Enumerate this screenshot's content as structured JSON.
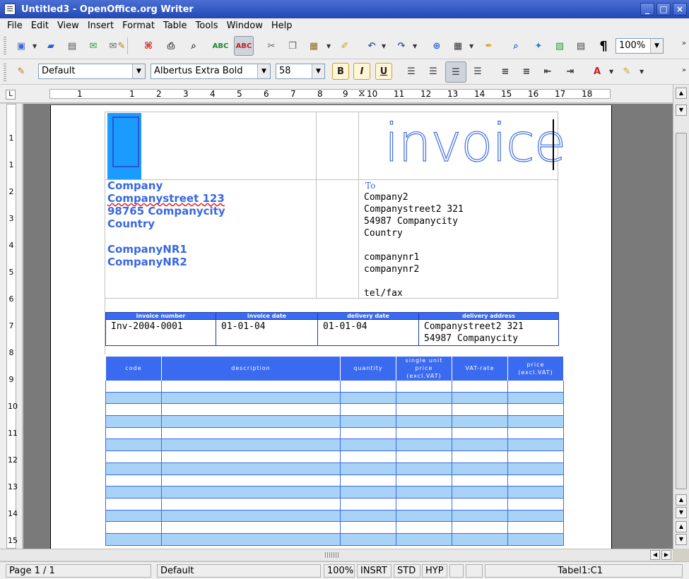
{
  "window": {
    "title": "Untitled3 - OpenOffice.org Writer"
  },
  "menu": [
    "File",
    "Edit",
    "View",
    "Insert",
    "Format",
    "Table",
    "Tools",
    "Window",
    "Help"
  ],
  "toolbar": {
    "zoom": "100%",
    "style": "Default",
    "font": "Albertus Extra Bold",
    "size": "58",
    "bold": "B",
    "italic": "I",
    "underline": "U",
    "spell_label": "ABC",
    "autospell_label": "ABC",
    "pilcrow": "¶"
  },
  "ruler": {
    "corner": "L",
    "h": [
      "1",
      "1",
      "2",
      "3",
      "4",
      "5",
      "6",
      "7",
      "8",
      "9",
      "10",
      "11",
      "12",
      "13",
      "14",
      "15",
      "16",
      "17",
      "18"
    ],
    "v": [
      "1",
      "1",
      "2",
      "3",
      "4",
      "5",
      "6",
      "7",
      "8",
      "9",
      "10",
      "11",
      "12",
      "13",
      "14",
      "15"
    ]
  },
  "invoice": {
    "heading": "invoice",
    "sender": [
      "Company",
      "Companystreet 123",
      "98765 Companycity",
      "Country",
      "",
      "CompanyNR1",
      "CompanyNR2"
    ],
    "to_label": "To",
    "recipient": [
      "Company2",
      "Companystreet2 321",
      "54987 Companycity",
      "Country",
      "",
      "companynr1",
      "companynr2",
      "",
      "tel/fax"
    ],
    "info_headers": [
      "invoice number",
      "invoice date",
      "delivery date",
      "delivery address"
    ],
    "info_values": {
      "number": "Inv-2004-0001",
      "invoice_date": "01-01-04",
      "delivery_date": "01-01-04",
      "address_line1": "Companystreet2 321",
      "address_line2": "54987 Companycity"
    },
    "item_headers": [
      "code",
      "description",
      "quantity",
      "single unit price (excl.VAT)",
      "VAT-rate",
      "price (excl.VAT)"
    ]
  },
  "status": {
    "page": "Page 1 / 1",
    "style": "Default",
    "zoom": "100%",
    "insert": "INSRT",
    "std": "STD",
    "hyp": "HYP",
    "cell": "Tabel1:C1"
  }
}
